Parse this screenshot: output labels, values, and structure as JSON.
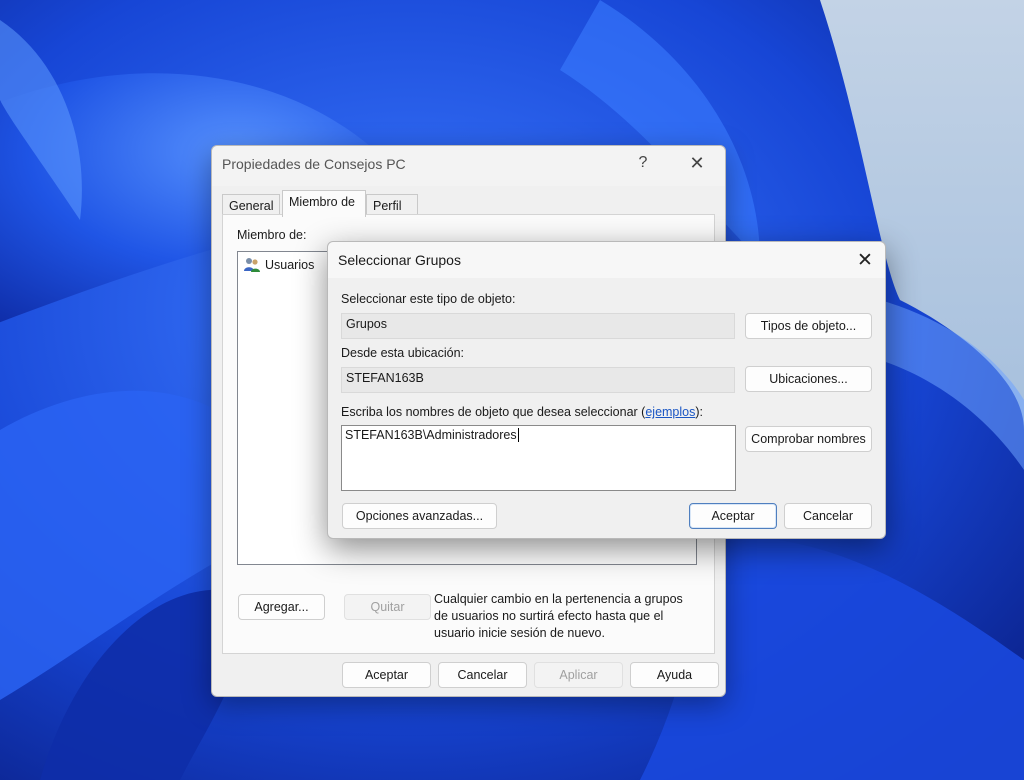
{
  "props_dialog": {
    "title": "Propiedades de Consejos PC",
    "help_symbol": "?",
    "close_symbol": "✕",
    "tabs": [
      {
        "label": "General"
      },
      {
        "label": "Miembro de"
      },
      {
        "label": "Perfil"
      }
    ],
    "member_of_label": "Miembro de:",
    "groups": [
      {
        "name": "Usuarios",
        "icon": "users-icon"
      }
    ],
    "add_button": "Agregar...",
    "remove_button": "Quitar",
    "info_text": "Cualquier cambio en la pertenencia a grupos de usuarios no surtirá efecto hasta que el usuario inicie sesión de nuevo.",
    "footer": {
      "ok": "Aceptar",
      "cancel": "Cancelar",
      "apply": "Aplicar",
      "help": "Ayuda"
    }
  },
  "select_dialog": {
    "title": "Seleccionar Grupos",
    "close_symbol": "✕",
    "object_type_label": "Seleccionar este tipo de objeto:",
    "object_type_value": "Grupos",
    "object_types_button": "Tipos de objeto...",
    "location_label": "Desde esta ubicación:",
    "location_value": "STEFAN163B",
    "locations_button": "Ubicaciones...",
    "names_label_prefix": "Escriba los nombres de objeto que desea seleccionar (",
    "names_label_link": "ejemplos",
    "names_label_suffix": "):",
    "names_value": "STEFAN163B\\Administradores",
    "check_names_button": "Comprobar nombres",
    "advanced_button": "Opciones avanzadas...",
    "ok": "Aceptar",
    "cancel": "Cancelar"
  },
  "colors": {
    "wallpaper_blue": "#1e49d8",
    "wallpaper_sky": "#a9c1dd",
    "link": "#1a56c4"
  }
}
